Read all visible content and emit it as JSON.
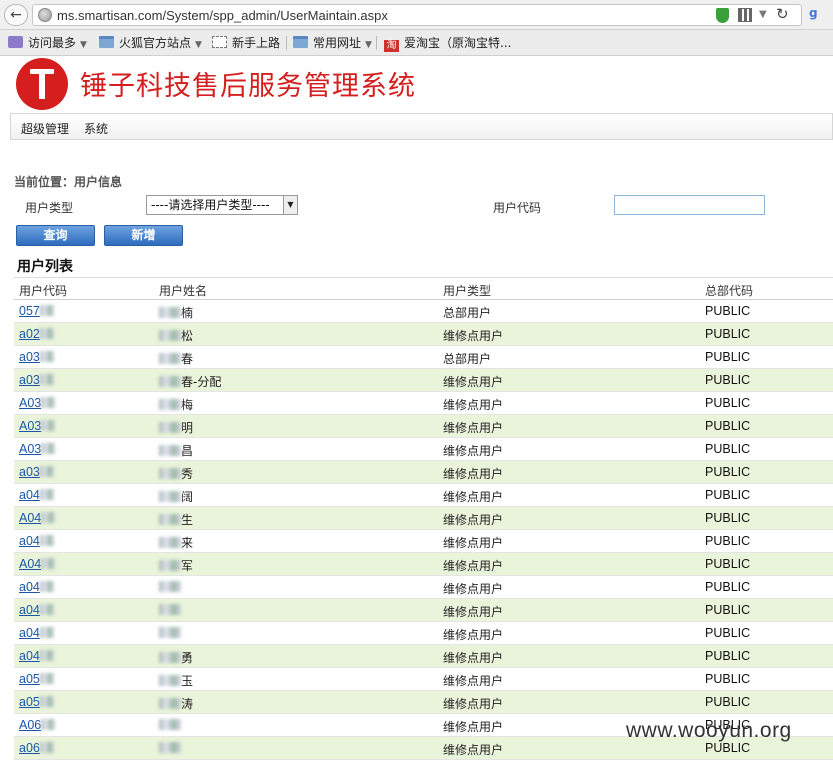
{
  "browser": {
    "url": "ms.smartisan.com/System/spp_admin/UserMaintain.aspx",
    "bookmarks": [
      {
        "label": "访问最多",
        "icon": "gear-icon",
        "dropdown": true
      },
      {
        "label": "火狐官方站点",
        "icon": "folder-icon",
        "dropdown": true
      },
      {
        "label": "新手上路",
        "icon": "page-icon",
        "dropdown": false
      },
      {
        "label": "常用网址",
        "icon": "folder-icon",
        "dropdown": true
      },
      {
        "label": "爱淘宝（原淘宝特...",
        "icon": "taobao-icon",
        "dropdown": false
      }
    ]
  },
  "app": {
    "title": "锤子科技售后服务管理系统",
    "brand_color": "#d51f1f",
    "menu": [
      "超级管理",
      "系统"
    ]
  },
  "search": {
    "breadcrumb": "当前位置：用户信息",
    "user_type_label": "用户类型",
    "user_type_value": "----请选择用户类型----",
    "user_code_label": "用户代码",
    "user_code_value": "",
    "query_button": "查询",
    "add_button": "新增"
  },
  "list": {
    "title": "用户列表",
    "columns": [
      "用户代码",
      "用户姓名",
      "用户类型",
      "总部代码"
    ],
    "rows": [
      {
        "code": "057",
        "name": "楠",
        "type": "总部用户",
        "hq": "PUBLIC"
      },
      {
        "code": "a02",
        "name": "松",
        "type": "维修点用户",
        "hq": "PUBLIC"
      },
      {
        "code": "a03",
        "name": "春",
        "type": "总部用户",
        "hq": "PUBLIC"
      },
      {
        "code": "a03",
        "name": "春-分配",
        "type": "维修点用户",
        "hq": "PUBLIC"
      },
      {
        "code": "A03",
        "name": "梅",
        "type": "维修点用户",
        "hq": "PUBLIC"
      },
      {
        "code": "A03",
        "name": "明",
        "type": "维修点用户",
        "hq": "PUBLIC"
      },
      {
        "code": "A03",
        "name": "昌",
        "type": "维修点用户",
        "hq": "PUBLIC"
      },
      {
        "code": "a03",
        "name": "秀",
        "type": "维修点用户",
        "hq": "PUBLIC"
      },
      {
        "code": "a04",
        "name": "阔",
        "type": "维修点用户",
        "hq": "PUBLIC"
      },
      {
        "code": "A04",
        "name": "生",
        "type": "维修点用户",
        "hq": "PUBLIC"
      },
      {
        "code": "a04",
        "name": "来",
        "type": "维修点用户",
        "hq": "PUBLIC"
      },
      {
        "code": "A04",
        "name": "军",
        "type": "维修点用户",
        "hq": "PUBLIC"
      },
      {
        "code": "a04",
        "name": "",
        "type": "维修点用户",
        "hq": "PUBLIC"
      },
      {
        "code": "a04",
        "name": "",
        "type": "维修点用户",
        "hq": "PUBLIC"
      },
      {
        "code": "a04",
        "name": "",
        "type": "维修点用户",
        "hq": "PUBLIC"
      },
      {
        "code": "a04",
        "name": "勇",
        "type": "维修点用户",
        "hq": "PUBLIC"
      },
      {
        "code": "a05",
        "name": "玉",
        "type": "维修点用户",
        "hq": "PUBLIC"
      },
      {
        "code": "a05",
        "name": "涛",
        "type": "维修点用户",
        "hq": "PUBLIC"
      },
      {
        "code": "A06",
        "name": "",
        "type": "维修点用户",
        "hq": "PUBLIC"
      },
      {
        "code": "a06",
        "name": "",
        "type": "维修点用户",
        "hq": "PUBLIC"
      }
    ]
  },
  "watermark": "www.wooyun.org"
}
